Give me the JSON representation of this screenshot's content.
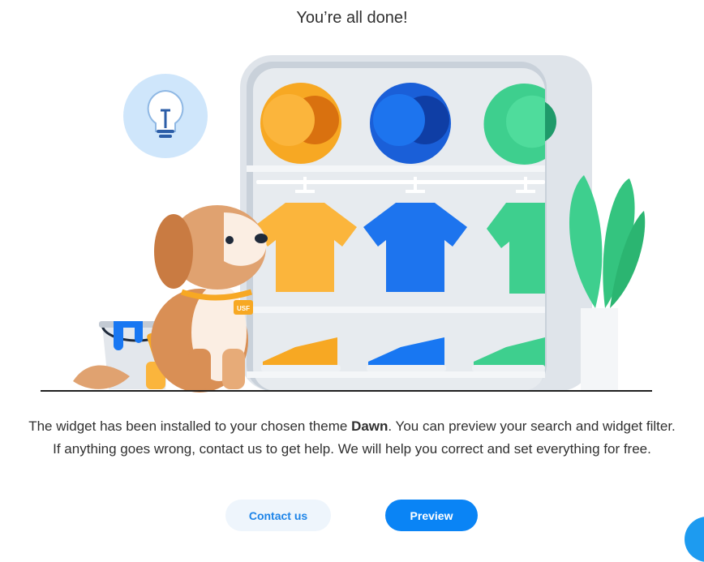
{
  "header": {
    "title": "You’re all done!"
  },
  "message": {
    "line1_before": "The widget has been installed to your chosen theme ",
    "theme_name": "Dawn",
    "line1_after": ". You can preview your search and widget filter.",
    "line2": "If anything goes wrong, contact us to get help. We will help you correct and set everything for free."
  },
  "illustration": {
    "collar_tag": "USF"
  },
  "actions": {
    "contact_label": "Contact us",
    "preview_label": "Preview"
  },
  "colors": {
    "accent": "#0a84f5",
    "contact_bg": "#eef5fc",
    "contact_text": "#1d84e8",
    "orange": "#f7a823",
    "blue": "#1877f2",
    "green": "#3ecf8e"
  }
}
